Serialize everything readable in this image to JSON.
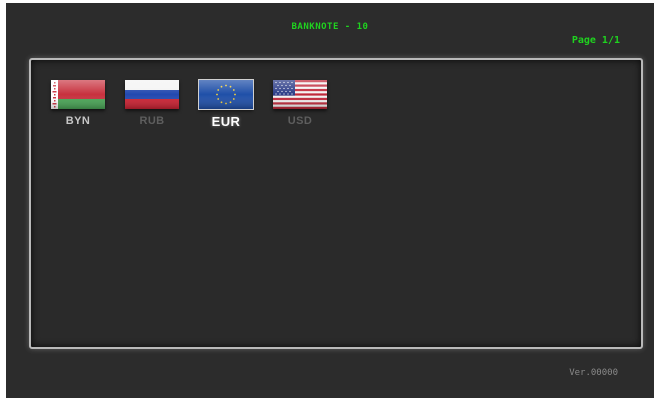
{
  "header": {
    "title": "BANKNOTE - 10",
    "page": "Page 1/1"
  },
  "currencies": [
    {
      "code": "BYN",
      "flag": "belarus-flag",
      "state": "normal"
    },
    {
      "code": "RUB",
      "flag": "russia-flag",
      "state": "disabled"
    },
    {
      "code": "EUR",
      "flag": "eu-flag",
      "state": "selected"
    },
    {
      "code": "USD",
      "flag": "usa-flag",
      "state": "disabled"
    }
  ],
  "footer": {
    "version": "Ver.00000"
  },
  "colors": {
    "background": "#2c2c2c",
    "accent_green": "#1fd21f",
    "panel_border": "#b9b9b9"
  }
}
